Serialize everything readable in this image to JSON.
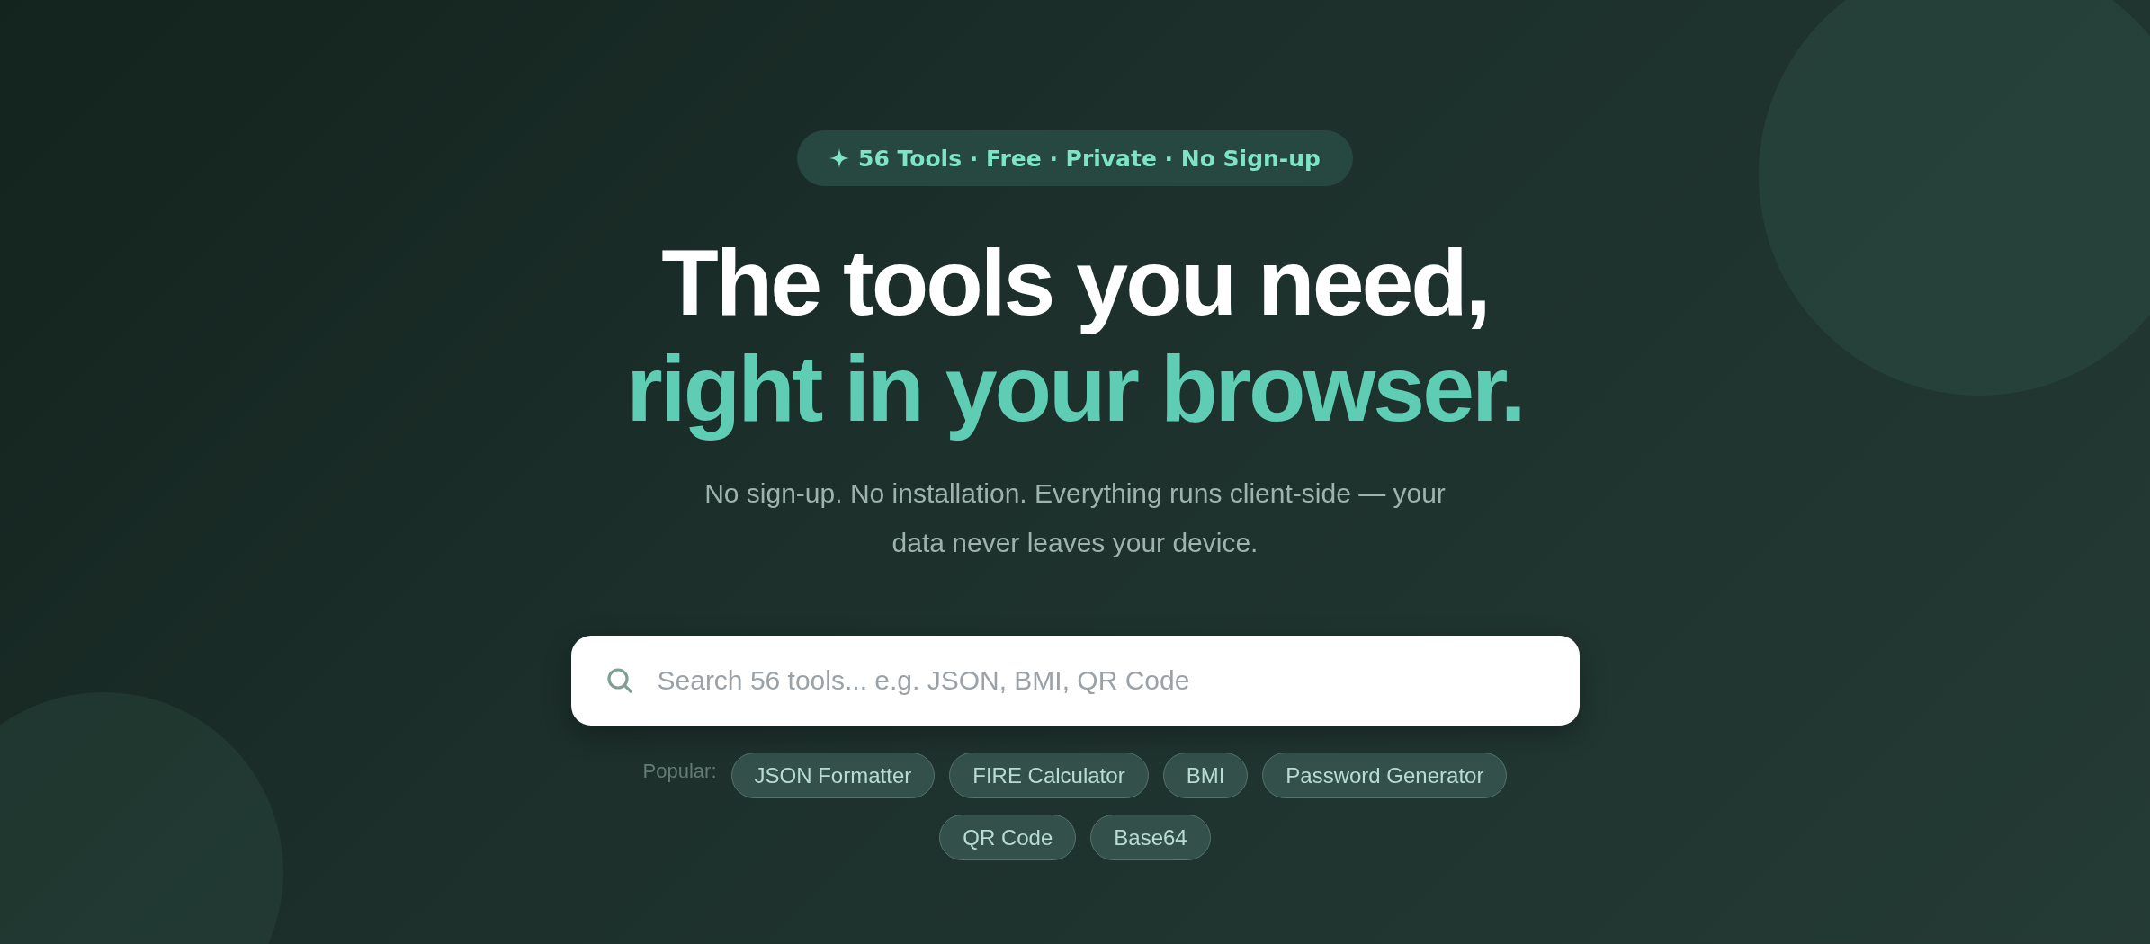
{
  "badge": {
    "text": "56 Tools · Free · Private · No Sign-up"
  },
  "heading": {
    "line_1": "The tools you need,",
    "line_2": "right in your browser."
  },
  "subtitle": "No sign-up. No installation. Everything runs client-side — your data never leaves your device.",
  "search": {
    "placeholder": "Search 56 tools... e.g. JSON, BMI, QR Code"
  },
  "popular": {
    "label": "Popular:",
    "chips": [
      "JSON Formatter",
      "FIRE Calculator",
      "BMI",
      "Password Generator",
      "QR Code",
      "Base64"
    ]
  }
}
